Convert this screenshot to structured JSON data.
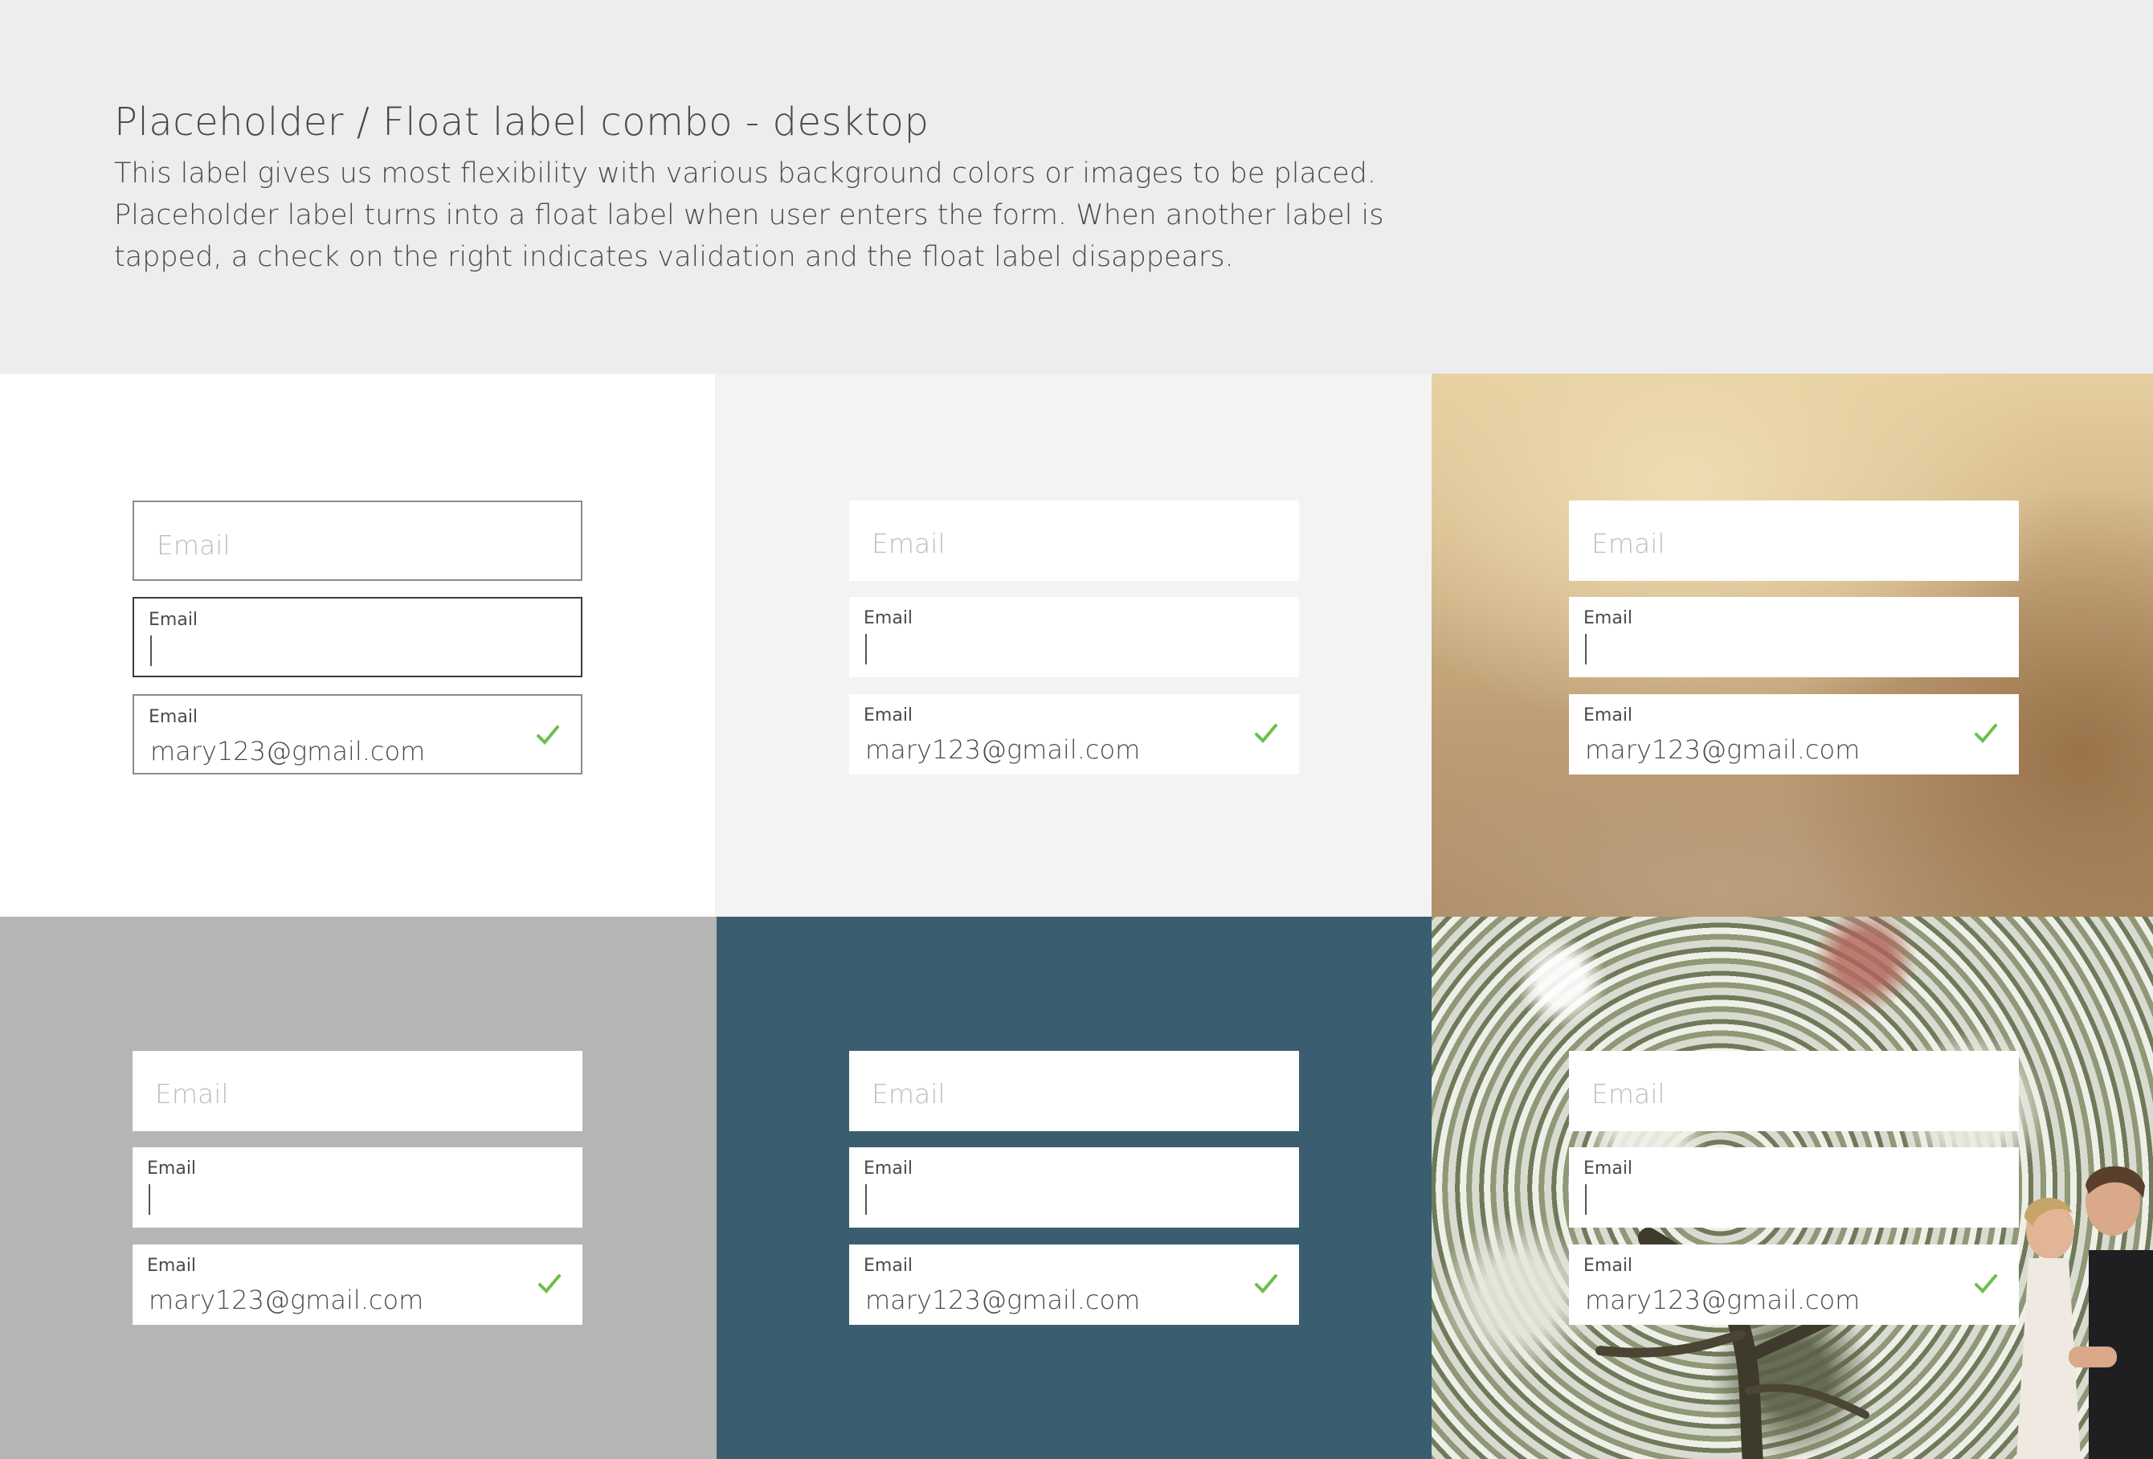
{
  "header": {
    "title": "Placeholder / Float label combo - desktop",
    "description": "This label gives us most flexibility with various background colors or images to be placed. Placeholder label turns into a float label when user enters the form. When another label is tapped, a check on the right indicates validation and the float label disappears."
  },
  "form": {
    "placeholder": "Email",
    "float_label": "Email",
    "filled_value": "mary123@gmail.com"
  },
  "panels": [
    {
      "name": "white"
    },
    {
      "name": "light-gray"
    },
    {
      "name": "gold-blur-photo"
    },
    {
      "name": "gray"
    },
    {
      "name": "slate-blue"
    },
    {
      "name": "blossom-photo"
    }
  ],
  "colors": {
    "check": "#6cc04a",
    "slate": "#3a5e6f",
    "gray": "#b5b5b5"
  }
}
